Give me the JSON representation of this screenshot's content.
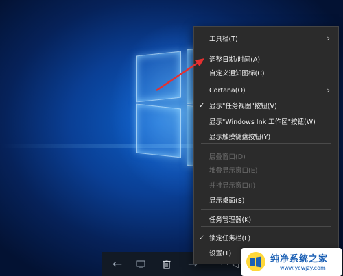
{
  "context_menu": {
    "items": [
      {
        "label": "工具栏(T)",
        "has_submenu": true,
        "checked": false,
        "disabled": false
      },
      {
        "label": "调整日期/时间(A)",
        "has_submenu": false,
        "checked": false,
        "disabled": false
      },
      {
        "label": "自定义通知图标(C)",
        "has_submenu": false,
        "checked": false,
        "disabled": false
      },
      {
        "label": "Cortana(O)",
        "has_submenu": true,
        "checked": false,
        "disabled": false
      },
      {
        "label": "显示\"任务视图\"按钮(V)",
        "has_submenu": false,
        "checked": true,
        "disabled": false
      },
      {
        "label": "显示\"Windows Ink 工作区\"按钮(W)",
        "has_submenu": false,
        "checked": false,
        "disabled": false
      },
      {
        "label": "显示触摸键盘按钮(Y)",
        "has_submenu": false,
        "checked": false,
        "disabled": false
      },
      {
        "label": "层叠窗口(D)",
        "has_submenu": false,
        "checked": false,
        "disabled": true
      },
      {
        "label": "堆叠显示窗口(E)",
        "has_submenu": false,
        "checked": false,
        "disabled": true
      },
      {
        "label": "并排显示窗口(I)",
        "has_submenu": false,
        "checked": false,
        "disabled": true
      },
      {
        "label": "显示桌面(S)",
        "has_submenu": false,
        "checked": false,
        "disabled": false
      },
      {
        "label": "任务管理器(K)",
        "has_submenu": false,
        "checked": false,
        "disabled": false
      },
      {
        "label": "锁定任务栏(L)",
        "has_submenu": false,
        "checked": true,
        "disabled": false
      },
      {
        "label": "设置(T)",
        "has_submenu": false,
        "checked": false,
        "disabled": false
      }
    ],
    "check_glyph": "✓",
    "submenu_glyph": "›"
  },
  "taskbar": {
    "icons": [
      "back-icon",
      "keyboard-icon",
      "delete-icon",
      "forward-icon"
    ],
    "glyphs": {
      "back": "←",
      "keyboard": "▭",
      "delete": "🗑",
      "forward": "→"
    }
  },
  "watermark": {
    "title": "纯净系统之家",
    "url": "www.ycwjzy.com"
  },
  "colors": {
    "menu_bg": "#2b2b2b",
    "menu_text": "#f1f1f1",
    "menu_disabled": "#6d6d6d",
    "annotation_arrow": "#e53030",
    "logo_blue": "#1a5fb4"
  }
}
